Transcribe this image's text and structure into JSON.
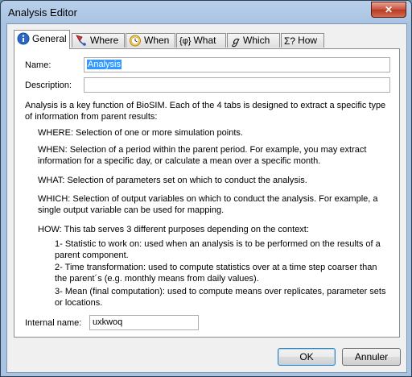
{
  "window": {
    "title": "Analysis Editor",
    "close_glyph": "✕"
  },
  "tabs": [
    {
      "label": "General",
      "icon": "info-icon"
    },
    {
      "label": "Where",
      "icon": "location-icon"
    },
    {
      "label": "When",
      "icon": "clock-icon"
    },
    {
      "label": "What",
      "icon": "phi-icon",
      "icon_text": "{φ}"
    },
    {
      "label": "Which",
      "icon": "gamma-icon",
      "icon_text": "ℊ"
    },
    {
      "label": "How",
      "icon": "sigma-icon",
      "icon_text": "Σ?"
    }
  ],
  "form": {
    "name_label": "Name:",
    "name_value": "Analysis",
    "description_label": "Description:",
    "description_value": "",
    "internal_name_label": "Internal name:",
    "internal_name_value": "uxkwoq"
  },
  "description": {
    "intro": "Analysis is a key function of BioSIM. Each of the 4 tabs is designed to extract a specific type of information from parent results:",
    "where": "WHERE: Selection of one or more simulation points.",
    "when": "WHEN: Selection of a period within the parent period. For example, you may extract information for a specific day, or calculate a mean over a specific month.",
    "what": "WHAT: Selection of parameters set on which to conduct the analysis.",
    "which": "WHICH: Selection of output variables on which to conduct the analysis. For example, a single output variable can be used for mapping.",
    "how": "HOW: This tab serves 3 different purposes depending on the context:",
    "how_1": "1- Statistic to work on: used when an analysis is to be performed on the results of a parent component.",
    "how_2": "2- Time transformation: used to compute statistics over at a time step coarser than the parent´s (e.g. monthly means from daily values).",
    "how_3": "3- Mean (final computation): used to compute means over replicates, parameter sets or locations."
  },
  "buttons": {
    "ok": "OK",
    "cancel": "Annuler"
  },
  "colors": {
    "selection": "#3399ff",
    "titlebar": "#b8d0ea",
    "close": "#c7503a"
  }
}
